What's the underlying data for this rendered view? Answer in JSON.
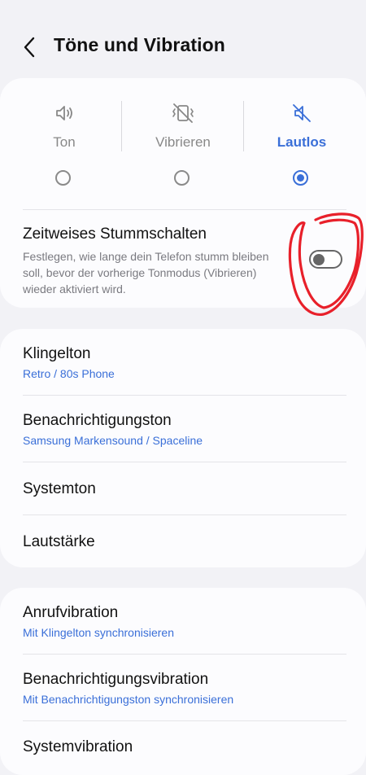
{
  "header": {
    "title": "Töne und Vibration"
  },
  "modes": [
    {
      "label": "Ton",
      "icon": "speaker-icon",
      "selected": false
    },
    {
      "label": "Vibrieren",
      "icon": "vibrate-icon",
      "selected": false
    },
    {
      "label": "Lautlos",
      "icon": "speaker-muted-icon",
      "selected": true
    }
  ],
  "temporary_mute": {
    "title": "Zeitweises Stummschalten",
    "description": "Festlegen, wie lange dein Telefon stumm bleiben soll, bevor der vorherige Tonmodus (Vibrieren) wieder aktiviert wird.",
    "enabled": false
  },
  "sound_settings": [
    {
      "title": "Klingelton",
      "subtitle": "Retro / 80s Phone"
    },
    {
      "title": "Benachrichtigungston",
      "subtitle": "Samsung Markensound / Spaceline"
    },
    {
      "title": "Systemton"
    },
    {
      "title": "Lautstärke"
    }
  ],
  "vibration_settings": [
    {
      "title": "Anrufvibration",
      "subtitle": "Mit Klingelton synchronisieren"
    },
    {
      "title": "Benachrichtigungsvibration",
      "subtitle": "Mit Benachrichtigungston synchronisieren"
    },
    {
      "title": "Systemvibration"
    }
  ],
  "colors": {
    "accent": "#3a6fd8",
    "background": "#f2f2f6",
    "card": "#fcfcfe",
    "annotation": "#e8202a"
  }
}
